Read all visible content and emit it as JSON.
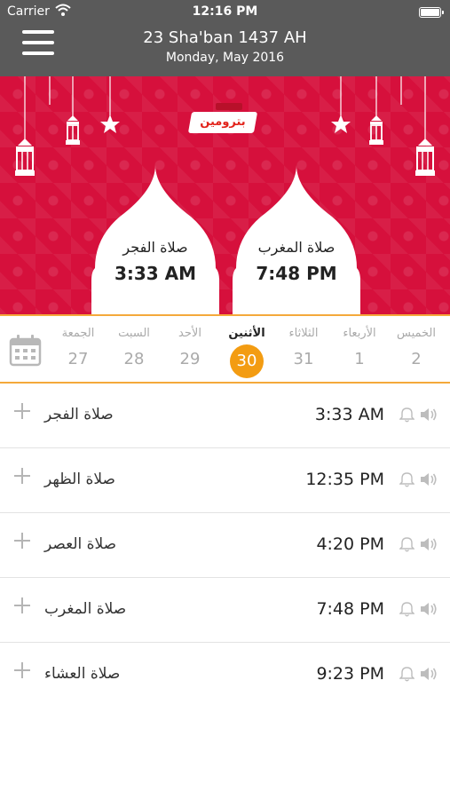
{
  "status_bar": {
    "carrier": "Carrier",
    "time": "12:16 PM"
  },
  "header": {
    "hijri_date": "23 Sha'ban 1437 AH",
    "gregorian_date": "Monday, May 2016"
  },
  "banner": {
    "logo_text": "بترومين",
    "domes": [
      {
        "name": "صلاة الفجر",
        "time": "3:33 AM"
      },
      {
        "name": "صلاة المغرب",
        "time": "7:48 PM"
      }
    ]
  },
  "week": {
    "days": [
      {
        "name": "الجمعة",
        "num": "27"
      },
      {
        "name": "السبت",
        "num": "28"
      },
      {
        "name": "الأحد",
        "num": "29"
      },
      {
        "name": "الأثنين",
        "num": "30"
      },
      {
        "name": "الثلاثاء",
        "num": "31"
      },
      {
        "name": "الأربعاء",
        "num": "1"
      },
      {
        "name": "الخميس",
        "num": "2"
      }
    ],
    "active_index": 3
  },
  "prayers": [
    {
      "name": "صلاة الفجر",
      "time": "3:33 AM"
    },
    {
      "name": "صلاة الظهر",
      "time": "12:35 PM"
    },
    {
      "name": "صلاة العصر",
      "time": "4:20 PM"
    },
    {
      "name": "صلاة المغرب",
      "time": "7:48 PM"
    },
    {
      "name": "صلاة العشاء",
      "time": "9:23 PM"
    }
  ],
  "icons": {
    "menu": "menu-icon",
    "calendar": "calendar-icon",
    "add": "plus-icon",
    "alarm": "bell-icon",
    "sound": "speaker-icon",
    "wifi": "wifi-icon",
    "battery": "battery-icon",
    "lantern": "lantern-icon",
    "moon": "moon-icon",
    "star": "star-icon"
  },
  "colors": {
    "header_bg": "#5a5a5a",
    "banner_red": "#d6103c",
    "accent_orange": "#f39c12",
    "divider_orange": "#f4a93b"
  }
}
